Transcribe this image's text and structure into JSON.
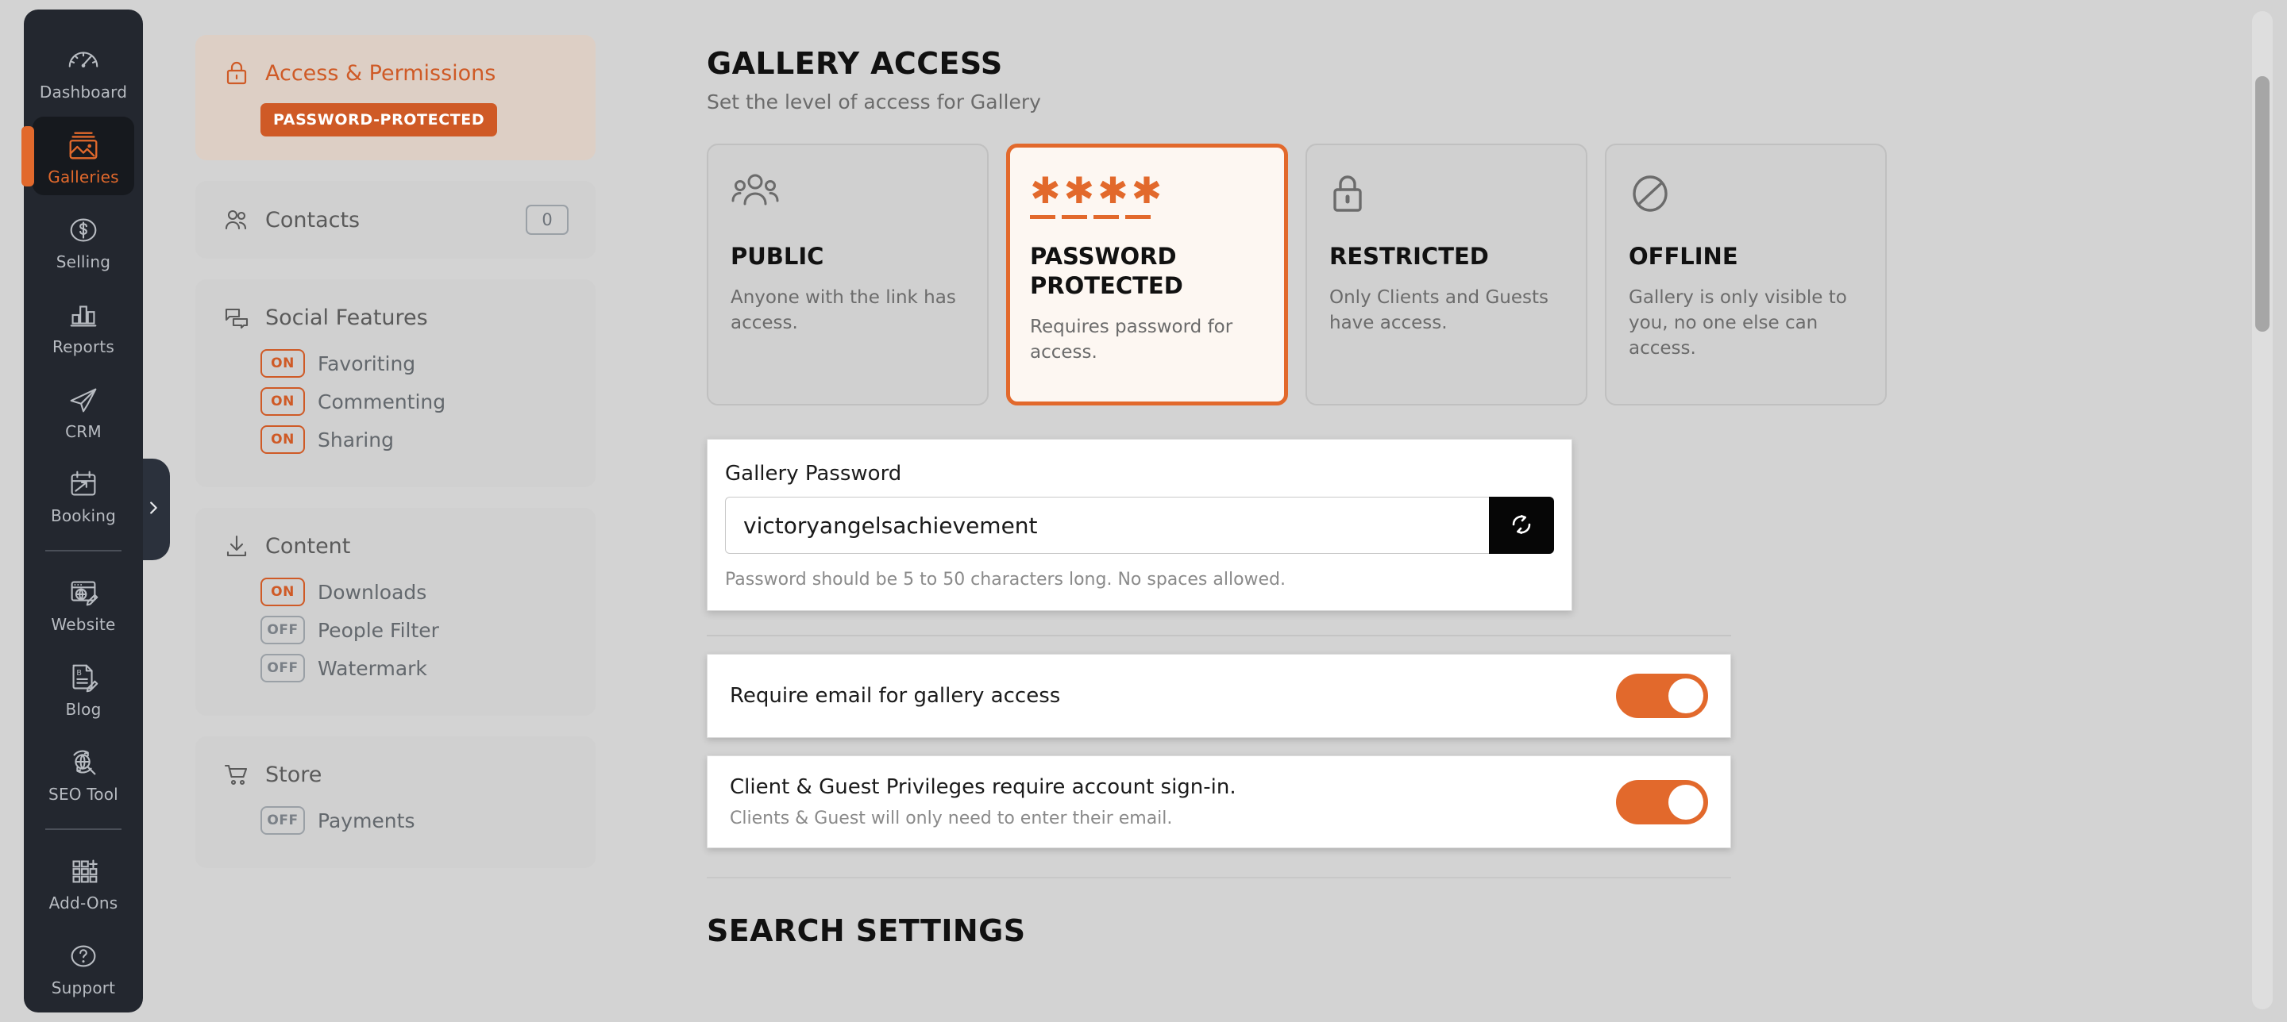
{
  "sidebar": {
    "items": [
      {
        "label": "Dashboard",
        "icon": "gauge-icon",
        "active": false
      },
      {
        "label": "Galleries",
        "icon": "image-stack-icon",
        "active": true
      },
      {
        "label": "Selling",
        "icon": "dollar-circle-icon",
        "active": false
      },
      {
        "label": "Reports",
        "icon": "bar-chart-icon",
        "active": false
      },
      {
        "label": "CRM",
        "icon": "paper-plane-icon",
        "active": false
      },
      {
        "label": "Booking",
        "icon": "calendar-arrow-icon",
        "active": false
      },
      {
        "label": "Website",
        "icon": "browser-globe-pencil-icon",
        "active": false
      },
      {
        "label": "Blog",
        "icon": "document-pencil-icon",
        "active": false
      },
      {
        "label": "SEO Tool",
        "icon": "globe-search-icon",
        "active": false
      },
      {
        "label": "Add-Ons",
        "icon": "grid-plus-icon",
        "active": false
      },
      {
        "label": "Support",
        "icon": "question-circle-icon",
        "active": false
      }
    ],
    "collapse_chevron": "chevron-right-icon"
  },
  "panel": {
    "access": {
      "title": "Access & Permissions",
      "icon": "lock-icon",
      "status_pill": "PASSWORD-PROTECTED"
    },
    "contacts": {
      "title": "Contacts",
      "icon": "people-icon",
      "count": "0"
    },
    "social": {
      "title": "Social Features",
      "icon": "chat-bubbles-icon",
      "features": [
        {
          "state": "ON",
          "label": "Favoriting",
          "on": true
        },
        {
          "state": "ON",
          "label": "Commenting",
          "on": true
        },
        {
          "state": "ON",
          "label": "Sharing",
          "on": true
        }
      ]
    },
    "content": {
      "title": "Content",
      "icon": "download-icon",
      "features": [
        {
          "state": "ON",
          "label": "Downloads",
          "on": true
        },
        {
          "state": "OFF",
          "label": "People Filter",
          "on": false
        },
        {
          "state": "OFF",
          "label": "Watermark",
          "on": false
        }
      ]
    },
    "store": {
      "title": "Store",
      "icon": "cart-icon",
      "features": [
        {
          "state": "OFF",
          "label": "Payments",
          "on": false
        }
      ]
    }
  },
  "main": {
    "heading": "GALLERY ACCESS",
    "subheading": "Set the level of access for Gallery",
    "access_levels": [
      {
        "name": "PUBLIC",
        "desc": "Anyone with the link has access.",
        "icon": "group-people-icon",
        "selected": false
      },
      {
        "name": "PASSWORD PROTECTED",
        "desc": "Requires password for access.",
        "icon": "asterisks-icon",
        "selected": true
      },
      {
        "name": "RESTRICTED",
        "desc": "Only Clients and Guests have access.",
        "icon": "padlock-icon",
        "selected": false
      },
      {
        "name": "OFFLINE",
        "desc": "Gallery is only visible to you, no one else can access.",
        "icon": "no-entry-icon",
        "selected": false
      }
    ],
    "password": {
      "label": "Gallery Password",
      "value": "victoryangelsachievement",
      "placeholder": "Enter gallery password",
      "hint": "Password should be 5 to 50 characters long. No spaces allowed.",
      "refresh_icon": "refresh-icon"
    },
    "settings": [
      {
        "title": "Require email for gallery access",
        "sub": "",
        "on": true
      },
      {
        "title": "Client & Guest Privileges require account sign-in.",
        "sub": "Clients & Guest will only need to enter their email.",
        "on": true
      }
    ],
    "search_heading": "SEARCH SETTINGS"
  },
  "colors": {
    "accent": "#e2692c",
    "accent_dark": "#cf5a26",
    "rail_bg": "#23272f",
    "page_bg": "#d3d3d3",
    "card_bg": "#d0d0d0",
    "selected_card_bg": "#fdf7f2",
    "active_panel_bg": "#ddcfc5"
  }
}
